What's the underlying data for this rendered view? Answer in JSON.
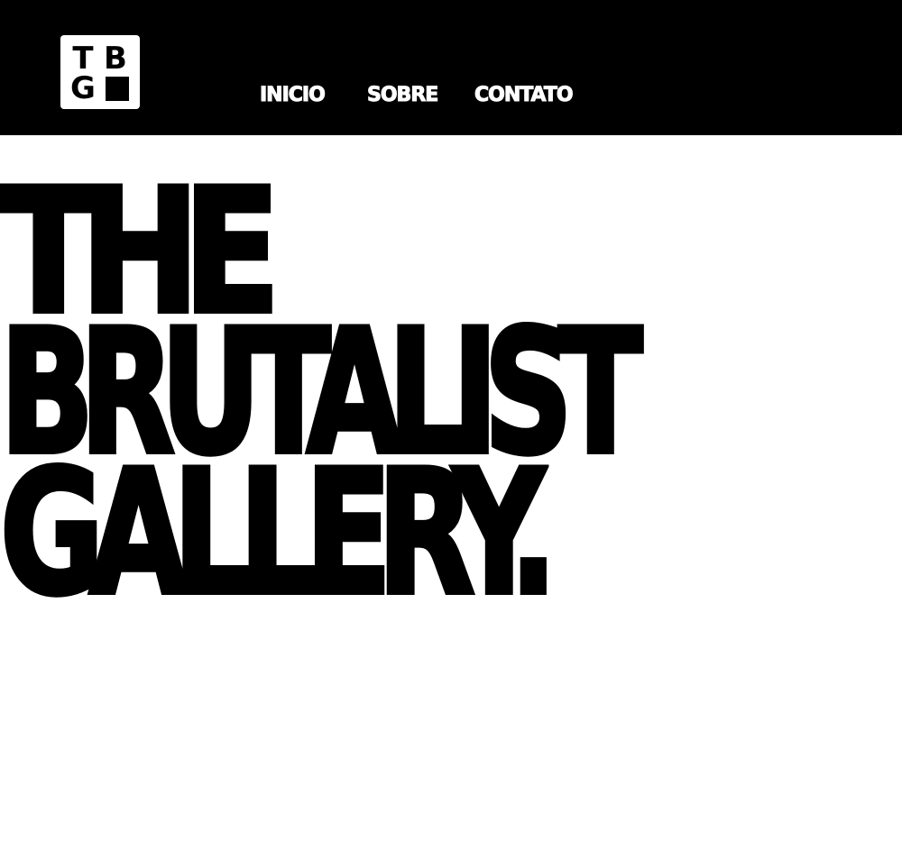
{
  "header": {
    "logo": {
      "letters": [
        "T",
        "B",
        "G"
      ]
    },
    "nav": [
      {
        "label": "INICIO"
      },
      {
        "label": "SOBRE"
      },
      {
        "label": "CONTATO"
      }
    ]
  },
  "hero": {
    "lines": [
      "THE",
      "BRUTALIST",
      "GALLERY."
    ]
  },
  "colors": {
    "background": "#ffffff",
    "header_background": "#000000",
    "nav_text": "#ffffff",
    "hero_text": "#000000"
  }
}
